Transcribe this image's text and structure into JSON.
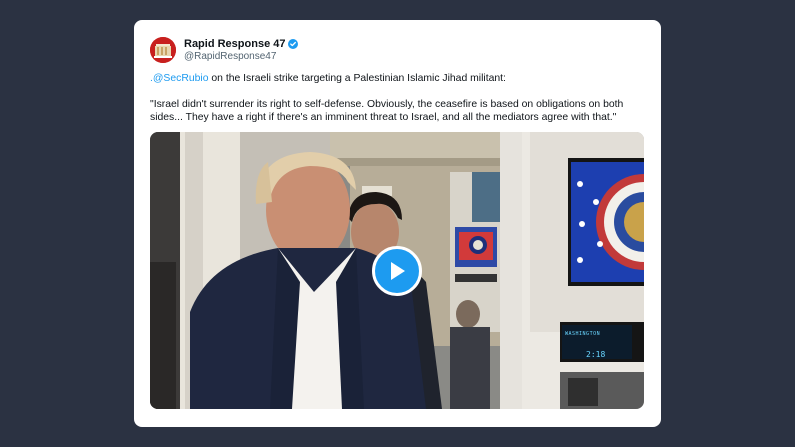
{
  "colors": {
    "page_background": "#2b3242",
    "card_background": "#ffffff",
    "link": "#1d9bf0",
    "avatar": "#c8201e",
    "play_button": "#1d9bf0"
  },
  "account": {
    "display_name": "Rapid Response 47",
    "handle": "@RapidResponse47",
    "verified_icon": "verified-badge-icon",
    "avatar_icon": "official-seal-icon"
  },
  "tweet": {
    "mention": ".@SecRubio",
    "intro_rest": " on the Israeli strike targeting a Palestinian Islamic Jihad militant:",
    "quote": "\"Israel didn't surrender its right to self-defense. Obviously, the ceasefire is based on obligations on both sides... They have a right if there's an imminent threat to Israel, and all the mediators agree with that.\""
  },
  "media": {
    "type": "video",
    "play_icon": "play-icon",
    "screen_label": "WASHINGTON",
    "screen_time": "2:18"
  }
}
